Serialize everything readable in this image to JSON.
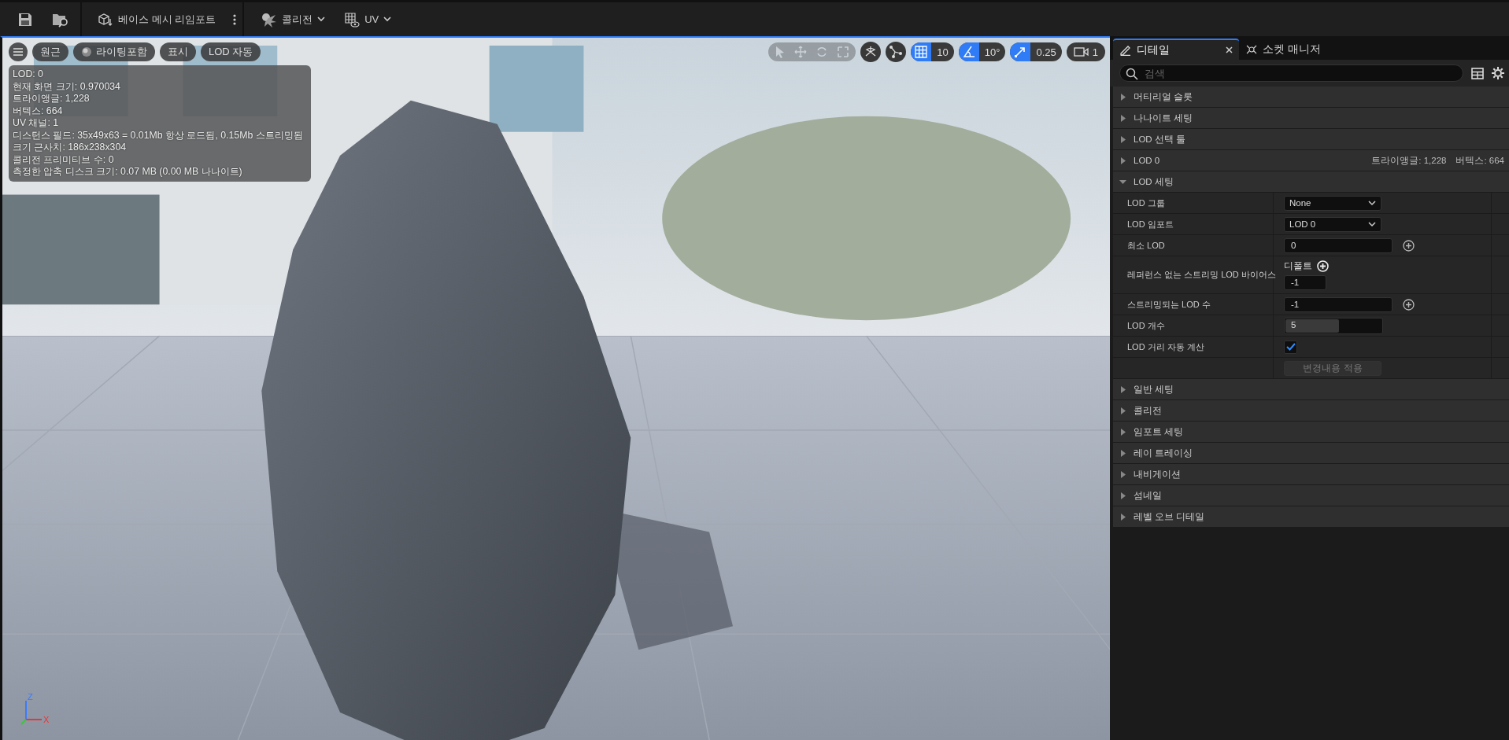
{
  "toolbar": {
    "buttons": [
      {
        "kind": "save"
      },
      {
        "kind": "browse"
      },
      {
        "kind": "reimport",
        "label": "베이스 메시 리임포트"
      },
      {
        "kind": "dropdown",
        "label": "콜리전"
      },
      {
        "kind": "dropdown",
        "label": "UV"
      }
    ]
  },
  "viewport": {
    "left_buttons": [
      {
        "label": "원근",
        "kind": "text"
      },
      {
        "label": "라이팅포함",
        "kind": "lighting"
      },
      {
        "label": "표시",
        "kind": "text"
      },
      {
        "label": "LOD 자동",
        "kind": "text"
      }
    ],
    "stats": [
      "LOD:  0",
      "현재 화면 크기: 0.970034",
      "트라이앵글: 1,228",
      "버텍스: 664",
      "UV 채널:  1",
      "디스턴스 필드:  35x49x63 = 0.01Mb 항상 로드됨, 0.15Mb 스트리밍됨",
      "크기 근사치: 186x238x304",
      "콜리전 프리미티브 수: 0",
      "측정한 압축 디스크 크기: 0.07 MB (0.00 MB 나나이트)"
    ],
    "transform_tools": {
      "disabled": true
    },
    "snap_controls": [
      {
        "kind": "grid",
        "value": "10",
        "on": true
      },
      {
        "kind": "angle",
        "value": "10°",
        "on": true
      },
      {
        "kind": "scale",
        "value": "0.25",
        "on": true
      }
    ],
    "camera_speed": "1",
    "axes": [
      "Z",
      "X"
    ]
  },
  "details": {
    "tabs": [
      {
        "label": "디테일",
        "selected": true
      },
      {
        "label": "소켓 매니저",
        "selected": false
      }
    ],
    "search": {
      "placeholder": "검색"
    },
    "sections": [
      {
        "title": "머티리얼 슬롯",
        "expanded": false
      },
      {
        "title": "나나이트 세팅",
        "expanded": false
      },
      {
        "title": "LOD 선택 툴",
        "expanded": false
      },
      {
        "title": "LOD 0",
        "expanded": false,
        "summary": [
          "트라이앵글: 1,228",
          "버텍스: 664"
        ]
      },
      {
        "title": "LOD 세팅",
        "expanded": true,
        "properties": [
          {
            "kind": "dropdown",
            "label": "LOD 그룹",
            "value": "None"
          },
          {
            "kind": "dropdown",
            "label": "LOD 임포트",
            "value": "LOD 0"
          },
          {
            "kind": "number",
            "label": "최소 LOD",
            "value": "0"
          },
          {
            "kind": "override",
            "label": "레퍼런스 없는 스트리밍 LOD 바이어스",
            "sublabel": "디폴트",
            "value": "-1"
          },
          {
            "kind": "number",
            "label": "스트리밍되는 LOD 수",
            "value": "-1"
          },
          {
            "kind": "slider",
            "label": "LOD 개수",
            "value": "5",
            "level": 0.55
          },
          {
            "kind": "checkbox",
            "label": "LOD 거리 자동 계산",
            "checked": true
          },
          {
            "kind": "button",
            "label": "변경내용 적용",
            "disabled": true
          }
        ]
      },
      {
        "title": "일반 세팅",
        "expanded": false
      },
      {
        "title": "콜리전",
        "expanded": false
      },
      {
        "title": "임포트 세팅",
        "expanded": false
      },
      {
        "title": "레이 트레이싱",
        "expanded": false
      },
      {
        "title": "내비게이션",
        "expanded": false
      },
      {
        "title": "섬네일",
        "expanded": false
      },
      {
        "title": "레벨 오브 디테일",
        "expanded": false
      }
    ]
  }
}
